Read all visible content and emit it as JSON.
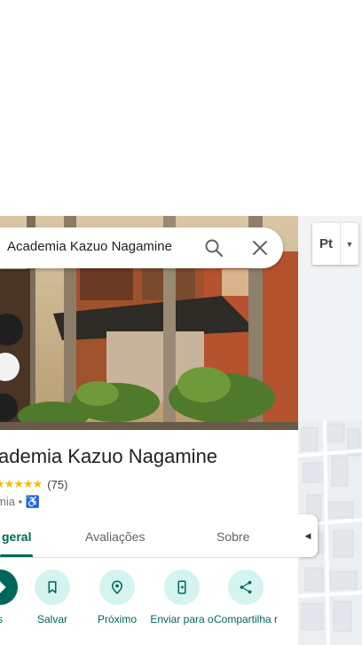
{
  "search": {
    "query": "Academia Kazuo Nagamine"
  },
  "place": {
    "name": "ademia Kazuo Nagamine",
    "stars": "★★★★★",
    "review_count": "(75)",
    "category": "mia",
    "separator": "•",
    "accessible_glyph": "♿"
  },
  "tabs": [
    {
      "label": "geral"
    },
    {
      "label": "Avaliações"
    },
    {
      "label": "Sobre"
    }
  ],
  "actions": [
    {
      "label": "s",
      "icon": "directions-icon"
    },
    {
      "label": "Salvar",
      "icon": "bookmark-icon"
    },
    {
      "label": "Próximo",
      "icon": "nearby-icon"
    },
    {
      "label": "Enviar para o",
      "icon": "send-to-phone-icon"
    },
    {
      "label": "Compartilha r",
      "icon": "share-icon"
    }
  ],
  "map": {
    "layer_label": "Pt"
  },
  "colors": {
    "accent": "#00665a",
    "accent_light": "#d5f3ef",
    "star": "#fbbc04",
    "link": "#1a73e8"
  }
}
